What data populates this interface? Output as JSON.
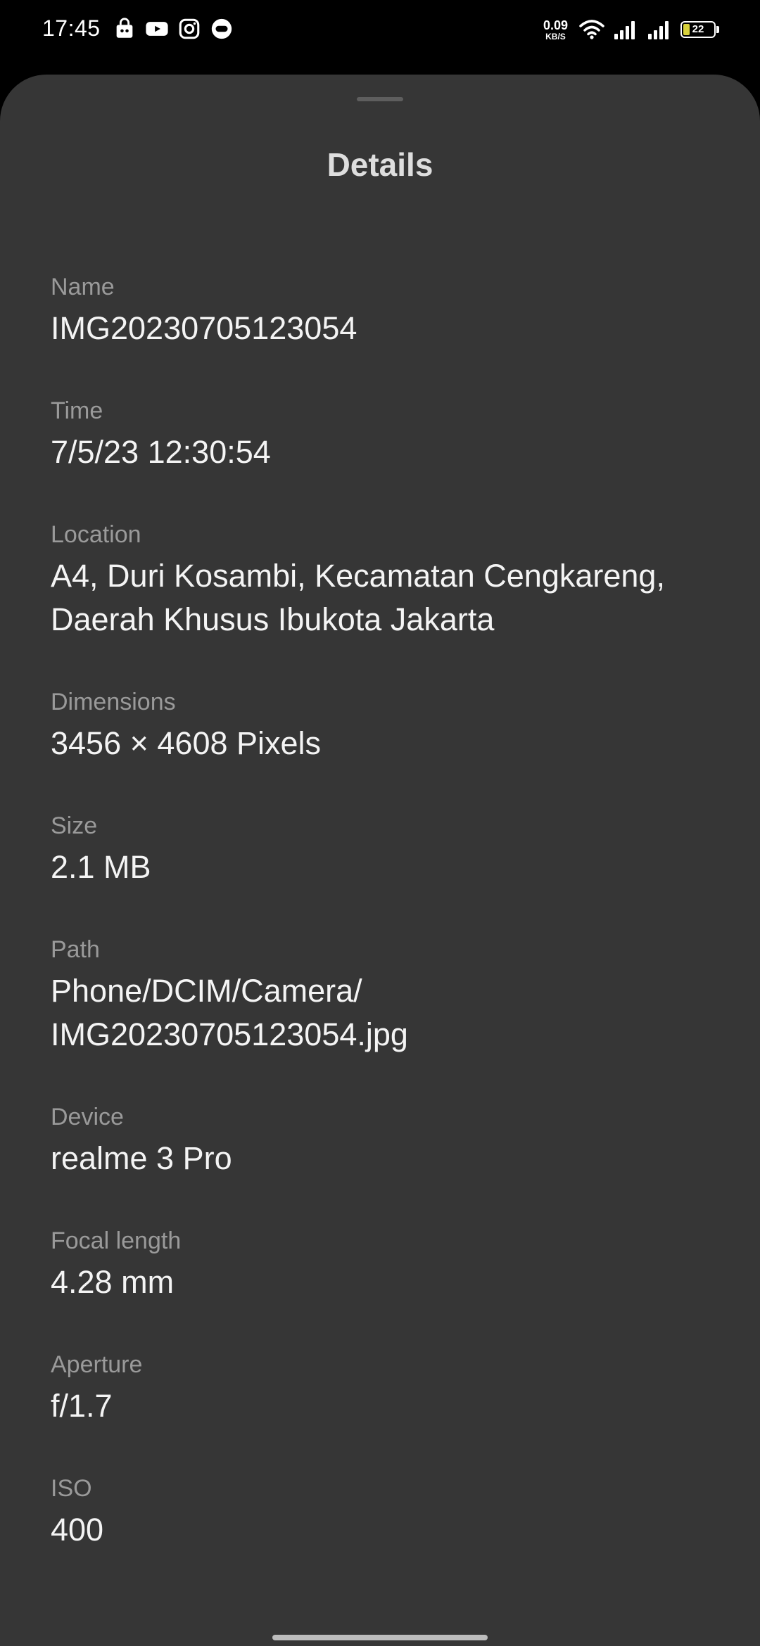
{
  "status_bar": {
    "time": "17:45",
    "net_speed_value": "0.09",
    "net_speed_unit": "KB/S",
    "battery_level": "22",
    "notification_icons": [
      "store-icon",
      "youtube-icon",
      "instagram-icon",
      "chat-bubble-icon"
    ],
    "right_icons": [
      "wifi-icon",
      "signal-icon",
      "signal-icon"
    ]
  },
  "sheet": {
    "title": "Details"
  },
  "details": [
    {
      "label": "Name",
      "value": "IMG20230705123054"
    },
    {
      "label": "Time",
      "value": "7/5/23 12:30:54"
    },
    {
      "label": "Location",
      "value": "A4, Duri Kosambi, Kecamatan Cengkareng, Daerah Khusus Ibukota Jakarta"
    },
    {
      "label": "Dimensions",
      "value": "3456 × 4608 Pixels"
    },
    {
      "label": "Size",
      "value": "2.1 MB"
    },
    {
      "label": "Path",
      "value": "Phone/DCIM/Camera/ IMG20230705123054.jpg"
    },
    {
      "label": "Device",
      "value": "realme 3 Pro"
    },
    {
      "label": "Focal length",
      "value": "4.28 mm"
    },
    {
      "label": "Aperture",
      "value": "f/1.7"
    },
    {
      "label": "ISO",
      "value": "400"
    }
  ],
  "colors": {
    "sheet_background": "#363636",
    "label_text": "#9a9a9a",
    "value_text": "#f4f4f4",
    "battery_fill": "#d8d23c"
  }
}
